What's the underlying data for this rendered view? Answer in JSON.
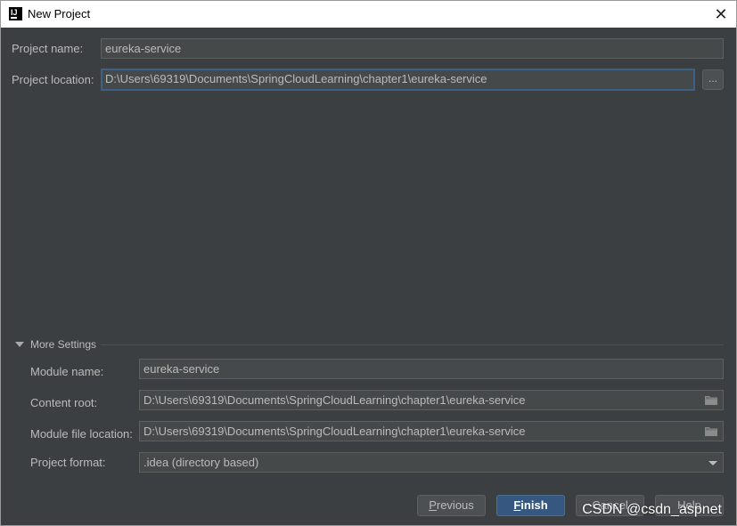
{
  "window": {
    "title": "New Project",
    "app_icon_text": "IJ"
  },
  "project": {
    "name_label": "Project name:",
    "name_value": "eureka-service",
    "location_label": "Project location:",
    "location_value": "D:\\Users\\69319\\Documents\\SpringCloudLearning\\chapter1\\eureka-service",
    "browse_label": "..."
  },
  "more_settings": {
    "title": "More Settings",
    "module_name_label": "Module name:",
    "module_name_value": "eureka-service",
    "content_root_label": "Content root:",
    "content_root_value": "D:\\Users\\69319\\Documents\\SpringCloudLearning\\chapter1\\eureka-service",
    "module_file_label": "Module file location:",
    "module_file_value": "D:\\Users\\69319\\Documents\\SpringCloudLearning\\chapter1\\eureka-service",
    "project_format_label": "Project format:",
    "project_format_value": ".idea (directory based)"
  },
  "buttons": {
    "previous_mnemonic": "P",
    "previous_rest": "revious",
    "finish_mnemonic": "F",
    "finish_rest": "inish",
    "cancel": "Cancel",
    "help": "Help"
  },
  "watermark": "CSDN @csdn_aspnet"
}
